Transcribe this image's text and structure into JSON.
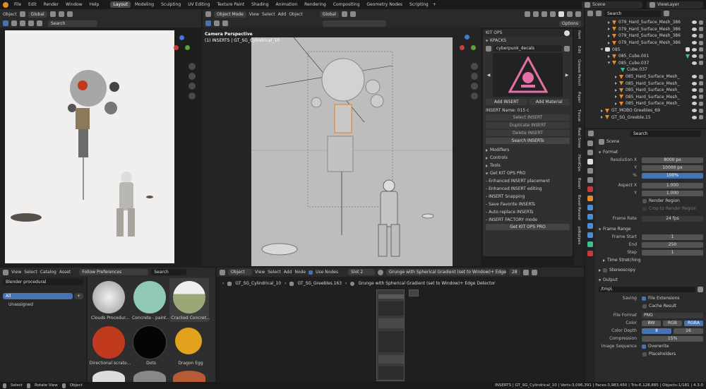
{
  "menu": {
    "items": [
      "File",
      "Edit",
      "Render",
      "Window",
      "Help"
    ]
  },
  "workspaces": [
    "Layout",
    "Modeling",
    "Sculpting",
    "UV Editing",
    "Texture Paint",
    "Shading",
    "Animation",
    "Rendering",
    "Compositing",
    "Geometry Nodes",
    "Scripting"
  ],
  "active_workspace": "Layout",
  "scene_name": "Scene",
  "view_layer": "ViewLayer",
  "left_view": {
    "mode": "Object",
    "orientation": "Global",
    "search_placeholder": "Search"
  },
  "center_view": {
    "mode": "Object Mode",
    "menus": [
      "View",
      "Select",
      "Add",
      "Object"
    ],
    "orientation": "Global",
    "options": "Options",
    "camera_label": "Camera Perspective",
    "object_label": "(1) INSERTS | GT_SG_Cylindrical_10"
  },
  "kitops": {
    "title": "KIT OPS",
    "kpacks": "KPACKS",
    "pack": "cyberpunk_decals",
    "add_insert": "Add INSERT",
    "add_material": "Add Material",
    "insert_name": "INSERT Name: 015 c",
    "buttons": [
      "Select INSERT",
      "Duplicate INSERT",
      "Delete INSERT"
    ],
    "search": "Search INSERTs",
    "sections": [
      "Modifiers",
      "Controls",
      "Tools",
      "Get KIT OPS PRO"
    ],
    "pro_items": [
      "- Enhanced INSERT placement",
      "- Enhanced INSERT editing",
      "- INSERT Snapping",
      "- Save Favorite INSERTs",
      "- Auto replace INSERTs",
      "- INSERT FACTORY mode"
    ],
    "get_pro": "Get KIT OPS PRO"
  },
  "side_tabs": [
    "Item",
    "Edit",
    "Grease Pencil",
    "Paper",
    "Tissue",
    "Real Snow",
    "HardOps",
    "Boxer",
    "Bevel-Reveal",
    "pdbpipes"
  ],
  "outliner": {
    "search_placeholder": "Search",
    "rows": [
      {
        "name": "079_Hard_Surface_Mesh_386",
        "type": "mesh",
        "indent": 1
      },
      {
        "name": "079_Hard_Surface_Mesh_386",
        "type": "mesh",
        "indent": 1
      },
      {
        "name": "079_Hard_Surface_Mesh_386",
        "type": "mesh",
        "indent": 1
      },
      {
        "name": "079_Hard_Surface_Mesh_386",
        "type": "mesh",
        "indent": 1
      },
      {
        "name": "085",
        "type": "collection",
        "indent": 0
      },
      {
        "name": "085_Cube.001",
        "type": "mesh",
        "indent": 1
      },
      {
        "name": "085_Cube.037",
        "type": "mesh",
        "indent": 1
      },
      {
        "name": "Cube.037",
        "type": "data",
        "indent": 2
      },
      {
        "name": "085_Hard_Surface_Mesh_",
        "type": "mesh",
        "indent": 1
      },
      {
        "name": "085_Hard_Surface_Mesh_",
        "type": "mesh",
        "indent": 1
      },
      {
        "name": "085_Hard_Surface_Mesh_",
        "type": "mesh",
        "indent": 1
      },
      {
        "name": "085_Hard_Surface_Mesh_",
        "type": "mesh",
        "indent": 1
      },
      {
        "name": "085_Hard_Surface_Mesh_",
        "type": "mesh",
        "indent": 1
      },
      {
        "name": "GT_MOBO Greebles_69",
        "type": "mesh",
        "indent": 0
      },
      {
        "name": "GT_SG_Greeble.15",
        "type": "mesh",
        "indent": 0
      }
    ]
  },
  "properties": {
    "search_placeholder": "Search",
    "scene": "Scene",
    "format": {
      "title": "Format",
      "resolution_x_label": "Resolution X",
      "resolution_x": "8000 px",
      "y_label": "Y",
      "resolution_y": "10000 px",
      "pct_label": "%",
      "percent": "100%",
      "aspect_x_label": "Aspect X",
      "aspect_x": "1.000",
      "aspect_y_label": "Y",
      "aspect_y": "1.000",
      "render_region": "Render Region",
      "crop": "Crop to Render Region",
      "frame_rate_label": "Frame Rate",
      "frame_rate": "24 fps"
    },
    "frame_range": {
      "title": "Frame Range",
      "start_label": "Frame Start",
      "start": "1",
      "end_label": "End",
      "end": "250",
      "step_label": "Step",
      "step": "1"
    },
    "time_stretching": "Time Stretching",
    "stereoscopy": "Stereoscopy",
    "output": {
      "title": "Output",
      "path": "/tmp\\",
      "saving_label": "Saving",
      "file_extensions": "File Extensions",
      "cache_result": "Cache Result",
      "file_format_label": "File Format",
      "file_format": "PNG",
      "color_label": "Color",
      "color_options": [
        "BW",
        "RGB",
        "RGBA"
      ],
      "color_selected": "RGBA",
      "depth_label": "Color Depth",
      "depth_options": [
        "8",
        "16"
      ],
      "depth_selected": "8",
      "compression_label": "Compression",
      "compression": "15%",
      "sequence_label": "Image Sequence",
      "overwrite": "Overwrite",
      "placeholders": "Placeholders"
    }
  },
  "asset_browser": {
    "menus": [
      "View",
      "Select",
      "Catalog",
      "Asset"
    ],
    "follow": "Follow Preferences",
    "library": "Blender procedural",
    "search_placeholder": "Search",
    "catalogs": [
      "All",
      "Unassigned"
    ],
    "assets": [
      {
        "name": "Clouds Procedur...",
        "color": "#d8d8d8"
      },
      {
        "name": "Concrete - paint...",
        "color": "#8fc8b4"
      },
      {
        "name": "Cracked Concret...",
        "color": "#9aa878"
      },
      {
        "name": "Directional scrato...",
        "color": "#c23a1e"
      },
      {
        "name": "Dots",
        "color": "#050505"
      },
      {
        "name": "Dragon Egg",
        "color": "#e2a21d"
      }
    ]
  },
  "node_editor": {
    "object": "Object",
    "menus": [
      "View",
      "Select",
      "Add",
      "Node"
    ],
    "use_nodes": "Use Nodes",
    "slot": "Slot 2",
    "material": "Grunge with Spherical Gradient (set to Window)+ Edge D...",
    "users": "28",
    "breadcrumb": [
      "GT_SG_Cylindrical_10",
      "GT_SG_Greebles.163",
      "Grunge with Spherical Gradient (set to Window)+ Edge Detector"
    ]
  },
  "status": {
    "left": [
      "Select",
      "Rotate View",
      "Object"
    ],
    "right": "INSERTS | GT_SG_Cylindrical_10 | Verts:3,096,391 | Faces:3,983,450 | Tris:6,128,885 | Objects:1/181 | 4.3.0"
  },
  "colors": {
    "accent": "#4772b3",
    "orange": "#e38b2f",
    "header": "#2a2a2a",
    "bg": "#1d1d1d"
  }
}
